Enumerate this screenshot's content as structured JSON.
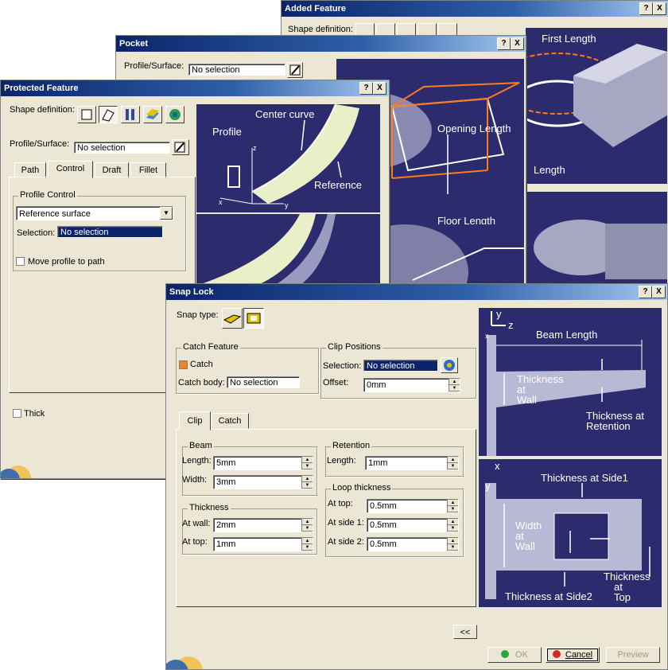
{
  "added_feature": {
    "title": "Added Feature",
    "shape_definition_label": "Shape definition:",
    "help": "?",
    "close": "X",
    "diagram_text_top": "First Length",
    "diagram_text_mid": "Length"
  },
  "pocket": {
    "title": "Pocket",
    "profile_label": "Profile/Surface:",
    "profile_value": "No selection",
    "help": "?",
    "close": "X",
    "diagram": {
      "opening_length": "Opening Length",
      "floor_length": "Floor Length"
    }
  },
  "protected_feature": {
    "title": "Protected Feature",
    "help": "?",
    "close": "X",
    "shape_definition_label": "Shape definition:",
    "profile_label": "Profile/Surface:",
    "profile_value": "No selection",
    "tabs": [
      "Path",
      "Control",
      "Draft",
      "Fillet"
    ],
    "profile_control_label": "Profile Control",
    "profile_control_value": "Reference surface",
    "selection_label": "Selection:",
    "selection_value": "No selection",
    "move_profile_label": "Move profile to path",
    "thick_label": "Thick",
    "diagram": {
      "center_curve": "Center curve",
      "profile": "Profile",
      "reference": "Reference",
      "axis_z": "z",
      "axis_x": "x",
      "axis_y": "y"
    }
  },
  "snap_lock": {
    "title": "Snap Lock",
    "help": "?",
    "close": "X",
    "snap_type_label": "Snap type:",
    "catch_feature": {
      "group_label": "Catch Feature",
      "catch_label": "Catch",
      "catch_body_label": "Catch body:",
      "catch_body_value": "No selection"
    },
    "clip_positions": {
      "group_label": "Clip Positions",
      "selection_label": "Selection:",
      "selection_value": "No selection",
      "offset_label": "Offset:",
      "offset_value": "0mm"
    },
    "tabs": [
      "Clip",
      "Catch"
    ],
    "beam": {
      "group_label": "Beam",
      "length_label": "Length:",
      "length_value": "5mm",
      "width_label": "Width:",
      "width_value": "3mm"
    },
    "thickness": {
      "group_label": "Thickness",
      "at_wall_label": "At wall:",
      "at_wall_value": "2mm",
      "at_top_label": "At top:",
      "at_top_value": "1mm"
    },
    "retention": {
      "group_label": "Retention",
      "length_label": "Length:",
      "length_value": "1mm"
    },
    "loop_thickness": {
      "group_label": "Loop thickness",
      "at_top_label": "At top:",
      "at_top_value": "0.5mm",
      "at_side1_label": "At side 1:",
      "at_side1_value": "0.5mm",
      "at_side2_label": "At side 2:",
      "at_side2_value": "0.5mm"
    },
    "collapse_button": "<<",
    "ok_button": "OK",
    "cancel_button": "Cancel",
    "preview_button": "Preview",
    "diagram_top": {
      "axis_y": "y",
      "axis_z": "z",
      "axis_x": "x",
      "beam_length": "Beam Length",
      "thickness_at_wall": [
        "Thickness",
        "at",
        "Wall"
      ],
      "thickness_at_retention": [
        "Thickness  at",
        "Retention"
      ]
    },
    "diagram_bottom": {
      "axis_x": "x",
      "axis_y": "y",
      "thickness_at_side1": "Thickness at Side1",
      "width_at_wall": [
        "Width",
        "at",
        "Wall"
      ],
      "thickness_at_top": [
        "Thickness",
        "at",
        "Top"
      ],
      "thickness_at_side2": "Thickness at Side2"
    }
  }
}
